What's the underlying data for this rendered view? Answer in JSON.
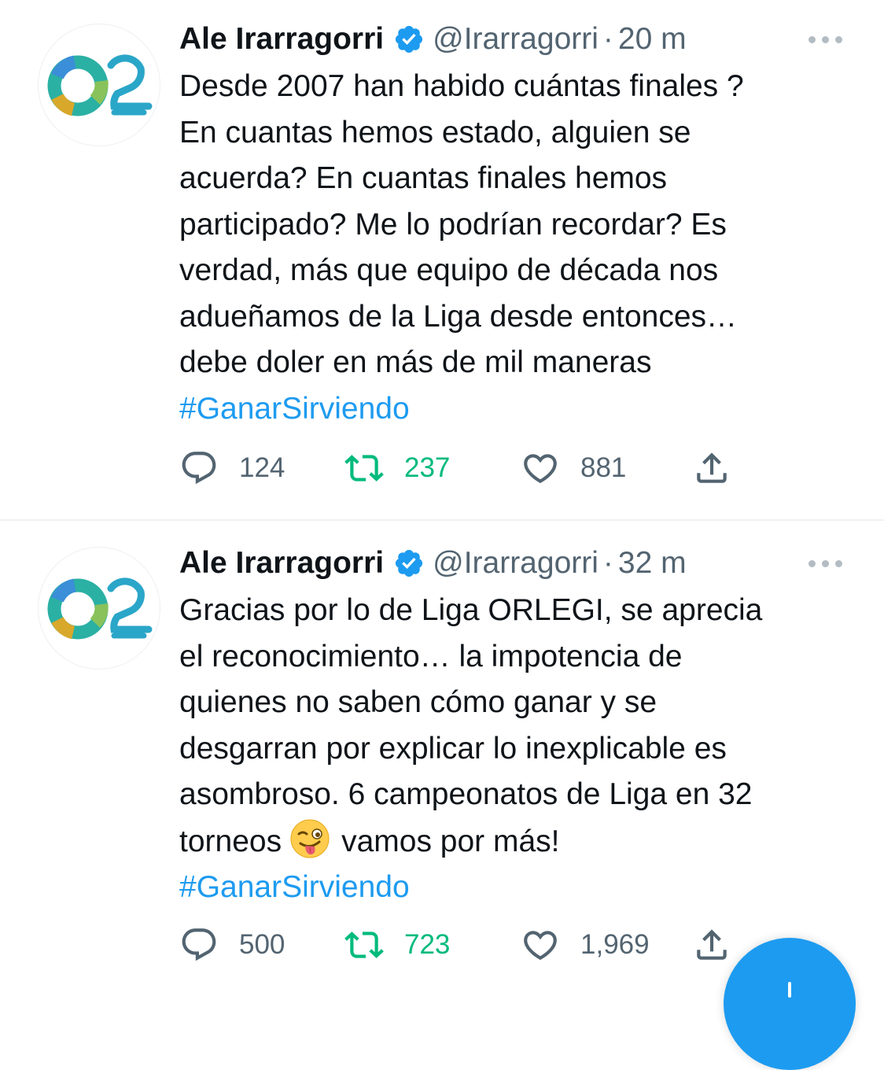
{
  "tweets": [
    {
      "name": "Ale Irarragorri",
      "handle": "@Irarragorri",
      "separator": "·",
      "time": "20 m",
      "lines": [
        "Desde 2007 han habido cuántas finales ?",
        "En cuantas hemos estado, alguien se",
        "acuerda? En cuantas finales hemos",
        "participado? Me lo podrían recordar? Es",
        "verdad, más que equipo de década nos",
        "adueñamos de la Liga desde entonces…",
        "debe doler en más de mil maneras"
      ],
      "hashtag": "#GanarSirviendo",
      "replies": "124",
      "retweets": "237",
      "likes": "881"
    },
    {
      "name": "Ale Irarragorri",
      "handle": "@Irarragorri",
      "separator": "·",
      "time": "32 m",
      "lines": [
        "Gracias por lo de Liga ORLEGI, se aprecia",
        "el reconocimiento… la impotencia de",
        "quienes no saben cómo ganar y se",
        "desgarran por explicar lo inexplicable es",
        "asombroso. 6 campeonatos de Liga en 32"
      ],
      "last_line_before_emoji": "torneos",
      "emoji": "winking-face-with-tongue",
      "last_line_after_emoji": "vamos por más!",
      "hashtag": "#GanarSirviendo",
      "replies": "500",
      "retweets": "723",
      "likes": "1,969"
    }
  ],
  "colors": {
    "text": "#0f1419",
    "secondary": "#536471",
    "link": "#1d9bf0",
    "retweet": "#00ba7c",
    "verified": "#1d9bf0"
  },
  "icons": [
    "avatar-logo",
    "verified-badge-icon",
    "more-icon",
    "reply-icon",
    "retweet-icon",
    "like-icon",
    "share-icon",
    "compose-icon"
  ]
}
